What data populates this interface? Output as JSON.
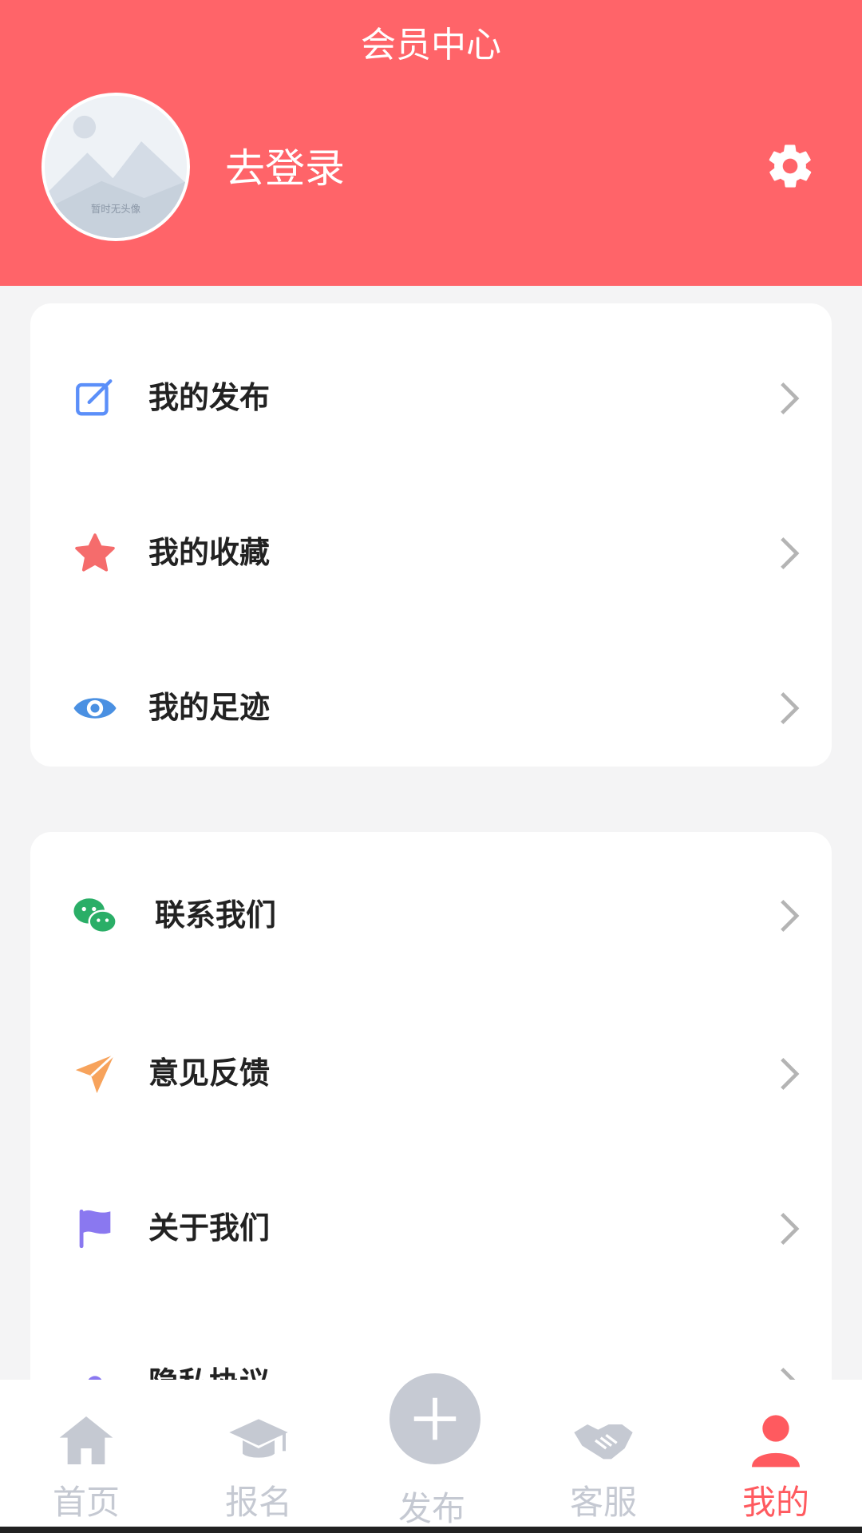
{
  "header": {
    "title": "会员中心",
    "login_label": "去登录",
    "avatar_caption": "暂时无头像",
    "settings_icon": "gear-icon",
    "background_color": "#ff6469"
  },
  "menu_group_1": [
    {
      "label": "我的发布",
      "icon": "edit-icon",
      "color": "#5b8ff9"
    },
    {
      "label": "我的收藏",
      "icon": "star-icon",
      "color": "#f56c6c"
    },
    {
      "label": "我的足迹",
      "icon": "eye-icon",
      "color": "#4a90e2"
    }
  ],
  "menu_group_2": [
    {
      "label": "联系我们",
      "icon": "wechat-icon",
      "color": "#2aae67"
    },
    {
      "label": "意见反馈",
      "icon": "paper-plane-icon",
      "color": "#f7a35c"
    },
    {
      "label": "关于我们",
      "icon": "flag-icon",
      "color": "#8a78f0"
    },
    {
      "label": "隐私协议",
      "icon": "slider-icon",
      "color": "#8a78f0"
    }
  ],
  "tabbar": {
    "items": [
      {
        "label": "首页",
        "icon": "home-icon"
      },
      {
        "label": "报名",
        "icon": "graduation-cap-icon"
      },
      {
        "label": "发布",
        "icon": "plus-icon"
      },
      {
        "label": "客服",
        "icon": "handshake-icon"
      },
      {
        "label": "我的",
        "icon": "user-icon"
      }
    ],
    "active": "我的",
    "active_color": "#ff5a5f",
    "inactive_color": "#c5c9d2"
  }
}
